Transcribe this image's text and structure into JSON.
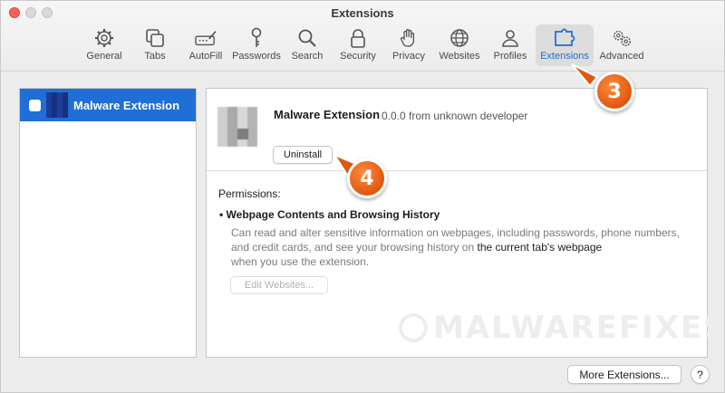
{
  "window": {
    "title": "Extensions"
  },
  "toolbar": {
    "tabs": [
      {
        "label": "General",
        "icon": "gear-icon"
      },
      {
        "label": "Tabs",
        "icon": "tabs-icon"
      },
      {
        "label": "AutoFill",
        "icon": "autofill-icon"
      },
      {
        "label": "Passwords",
        "icon": "key-icon"
      },
      {
        "label": "Search",
        "icon": "search-icon"
      },
      {
        "label": "Security",
        "icon": "lock-icon"
      },
      {
        "label": "Privacy",
        "icon": "hand-icon"
      },
      {
        "label": "Websites",
        "icon": "globe-icon"
      },
      {
        "label": "Profiles",
        "icon": "person-icon"
      },
      {
        "label": "Extensions",
        "icon": "puzzle-icon"
      },
      {
        "label": "Advanced",
        "icon": "gears-icon"
      }
    ],
    "active_tab": "Extensions",
    "accent_color": "#1a6ed8"
  },
  "sidebar": {
    "items": [
      {
        "label": "Malware Extension",
        "selected": true
      }
    ]
  },
  "detail": {
    "name": "Malware Extension",
    "meta": "0.0.0 from unknown developer",
    "uninstall_label": "Uninstall",
    "permissions_title": "Permissions:",
    "permission_heading": "Webpage Contents and Browsing History",
    "permission_desc_1": "Can read and alter sensitive information on webpages, including passwords, phone numbers, and credit cards, and see your browsing history on ",
    "permission_desc_2": "the current tab's webpage",
    "permission_desc_3": "when you use the extension.",
    "edit_websites_label": "Edit Websites..."
  },
  "footer": {
    "more_extensions_label": "More Extensions...",
    "help_label": "?"
  },
  "watermark": "MALWAREFIXES",
  "callouts": {
    "step_3": "3",
    "step_4": "4",
    "color": "#e0580f"
  }
}
